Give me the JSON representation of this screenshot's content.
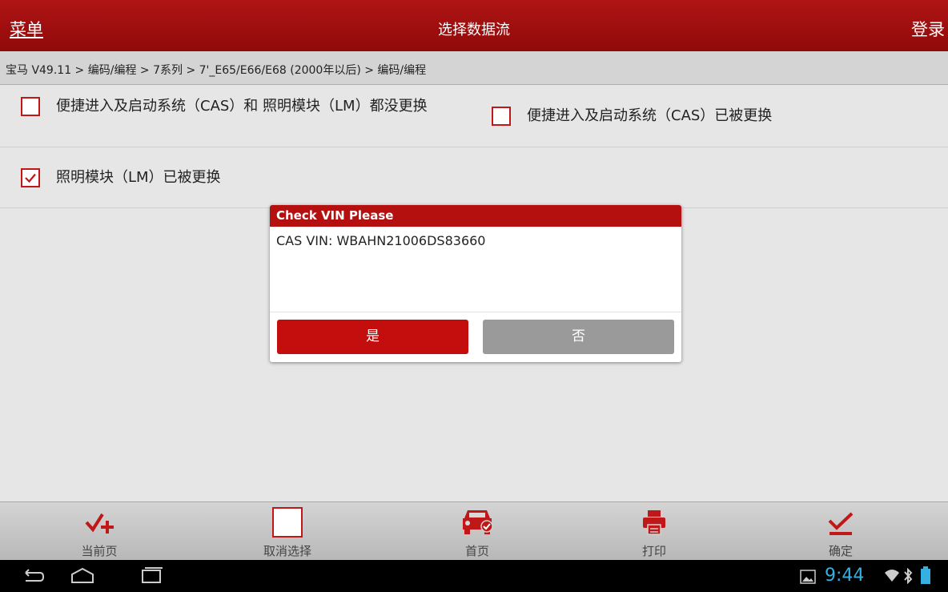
{
  "topbar": {
    "menu_label": "菜单",
    "title": "选择数据流",
    "login_label": "登录"
  },
  "breadcrumb": "宝马 V49.11 > 编码/编程 > 7系列 > 7'_E65/E66/E68 (2000年以后) > 编码/编程",
  "options": [
    {
      "label": "便捷进入及启动系统（CAS）和 照明模块（LM）都没更换",
      "checked": false
    },
    {
      "label": "便捷进入及启动系统（CAS）已被更换",
      "checked": false
    },
    {
      "label": "照明模块（LM）已被更换",
      "checked": true
    }
  ],
  "dialog": {
    "title": "Check VIN Please",
    "message": "CAS VIN: WBAHN21006DS83660",
    "yes_label": "是",
    "no_label": "否"
  },
  "bottombar": {
    "current_page": "当前页",
    "cancel_select": "取消选择",
    "home": "首页",
    "print": "打印",
    "confirm": "确定"
  },
  "statusbar": {
    "time": "9:44"
  },
  "colors": {
    "brand_red": "#b01414",
    "button_gray": "#9a9a9a",
    "clock_blue": "#35b0e0"
  },
  "icons": [
    "back-icon",
    "home-icon",
    "recent-apps-icon",
    "gallery-icon",
    "wifi-icon",
    "bluetooth-icon",
    "battery-icon",
    "check-plus-icon",
    "blank-square-icon",
    "car-icon",
    "printer-icon",
    "checkmark-icon"
  ]
}
